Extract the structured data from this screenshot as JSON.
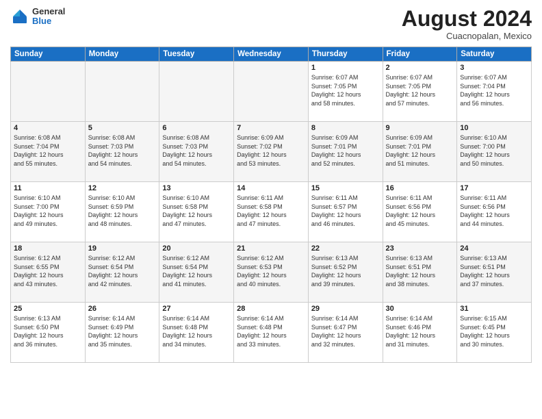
{
  "logo": {
    "general": "General",
    "blue": "Blue"
  },
  "title": {
    "month_year": "August 2024",
    "location": "Cuacnopalan, Mexico"
  },
  "weekdays": [
    "Sunday",
    "Monday",
    "Tuesday",
    "Wednesday",
    "Thursday",
    "Friday",
    "Saturday"
  ],
  "weeks": [
    [
      {
        "day": "",
        "info": "",
        "empty": true
      },
      {
        "day": "",
        "info": "",
        "empty": true
      },
      {
        "day": "",
        "info": "",
        "empty": true
      },
      {
        "day": "",
        "info": "",
        "empty": true
      },
      {
        "day": "1",
        "info": "Sunrise: 6:07 AM\nSunset: 7:05 PM\nDaylight: 12 hours\nand 58 minutes.",
        "empty": false
      },
      {
        "day": "2",
        "info": "Sunrise: 6:07 AM\nSunset: 7:05 PM\nDaylight: 12 hours\nand 57 minutes.",
        "empty": false
      },
      {
        "day": "3",
        "info": "Sunrise: 6:07 AM\nSunset: 7:04 PM\nDaylight: 12 hours\nand 56 minutes.",
        "empty": false
      }
    ],
    [
      {
        "day": "4",
        "info": "Sunrise: 6:08 AM\nSunset: 7:04 PM\nDaylight: 12 hours\nand 55 minutes.",
        "empty": false
      },
      {
        "day": "5",
        "info": "Sunrise: 6:08 AM\nSunset: 7:03 PM\nDaylight: 12 hours\nand 54 minutes.",
        "empty": false
      },
      {
        "day": "6",
        "info": "Sunrise: 6:08 AM\nSunset: 7:03 PM\nDaylight: 12 hours\nand 54 minutes.",
        "empty": false
      },
      {
        "day": "7",
        "info": "Sunrise: 6:09 AM\nSunset: 7:02 PM\nDaylight: 12 hours\nand 53 minutes.",
        "empty": false
      },
      {
        "day": "8",
        "info": "Sunrise: 6:09 AM\nSunset: 7:01 PM\nDaylight: 12 hours\nand 52 minutes.",
        "empty": false
      },
      {
        "day": "9",
        "info": "Sunrise: 6:09 AM\nSunset: 7:01 PM\nDaylight: 12 hours\nand 51 minutes.",
        "empty": false
      },
      {
        "day": "10",
        "info": "Sunrise: 6:10 AM\nSunset: 7:00 PM\nDaylight: 12 hours\nand 50 minutes.",
        "empty": false
      }
    ],
    [
      {
        "day": "11",
        "info": "Sunrise: 6:10 AM\nSunset: 7:00 PM\nDaylight: 12 hours\nand 49 minutes.",
        "empty": false
      },
      {
        "day": "12",
        "info": "Sunrise: 6:10 AM\nSunset: 6:59 PM\nDaylight: 12 hours\nand 48 minutes.",
        "empty": false
      },
      {
        "day": "13",
        "info": "Sunrise: 6:10 AM\nSunset: 6:58 PM\nDaylight: 12 hours\nand 47 minutes.",
        "empty": false
      },
      {
        "day": "14",
        "info": "Sunrise: 6:11 AM\nSunset: 6:58 PM\nDaylight: 12 hours\nand 47 minutes.",
        "empty": false
      },
      {
        "day": "15",
        "info": "Sunrise: 6:11 AM\nSunset: 6:57 PM\nDaylight: 12 hours\nand 46 minutes.",
        "empty": false
      },
      {
        "day": "16",
        "info": "Sunrise: 6:11 AM\nSunset: 6:56 PM\nDaylight: 12 hours\nand 45 minutes.",
        "empty": false
      },
      {
        "day": "17",
        "info": "Sunrise: 6:11 AM\nSunset: 6:56 PM\nDaylight: 12 hours\nand 44 minutes.",
        "empty": false
      }
    ],
    [
      {
        "day": "18",
        "info": "Sunrise: 6:12 AM\nSunset: 6:55 PM\nDaylight: 12 hours\nand 43 minutes.",
        "empty": false
      },
      {
        "day": "19",
        "info": "Sunrise: 6:12 AM\nSunset: 6:54 PM\nDaylight: 12 hours\nand 42 minutes.",
        "empty": false
      },
      {
        "day": "20",
        "info": "Sunrise: 6:12 AM\nSunset: 6:54 PM\nDaylight: 12 hours\nand 41 minutes.",
        "empty": false
      },
      {
        "day": "21",
        "info": "Sunrise: 6:12 AM\nSunset: 6:53 PM\nDaylight: 12 hours\nand 40 minutes.",
        "empty": false
      },
      {
        "day": "22",
        "info": "Sunrise: 6:13 AM\nSunset: 6:52 PM\nDaylight: 12 hours\nand 39 minutes.",
        "empty": false
      },
      {
        "day": "23",
        "info": "Sunrise: 6:13 AM\nSunset: 6:51 PM\nDaylight: 12 hours\nand 38 minutes.",
        "empty": false
      },
      {
        "day": "24",
        "info": "Sunrise: 6:13 AM\nSunset: 6:51 PM\nDaylight: 12 hours\nand 37 minutes.",
        "empty": false
      }
    ],
    [
      {
        "day": "25",
        "info": "Sunrise: 6:13 AM\nSunset: 6:50 PM\nDaylight: 12 hours\nand 36 minutes.",
        "empty": false
      },
      {
        "day": "26",
        "info": "Sunrise: 6:14 AM\nSunset: 6:49 PM\nDaylight: 12 hours\nand 35 minutes.",
        "empty": false
      },
      {
        "day": "27",
        "info": "Sunrise: 6:14 AM\nSunset: 6:48 PM\nDaylight: 12 hours\nand 34 minutes.",
        "empty": false
      },
      {
        "day": "28",
        "info": "Sunrise: 6:14 AM\nSunset: 6:48 PM\nDaylight: 12 hours\nand 33 minutes.",
        "empty": false
      },
      {
        "day": "29",
        "info": "Sunrise: 6:14 AM\nSunset: 6:47 PM\nDaylight: 12 hours\nand 32 minutes.",
        "empty": false
      },
      {
        "day": "30",
        "info": "Sunrise: 6:14 AM\nSunset: 6:46 PM\nDaylight: 12 hours\nand 31 minutes.",
        "empty": false
      },
      {
        "day": "31",
        "info": "Sunrise: 6:15 AM\nSunset: 6:45 PM\nDaylight: 12 hours\nand 30 minutes.",
        "empty": false
      }
    ]
  ]
}
